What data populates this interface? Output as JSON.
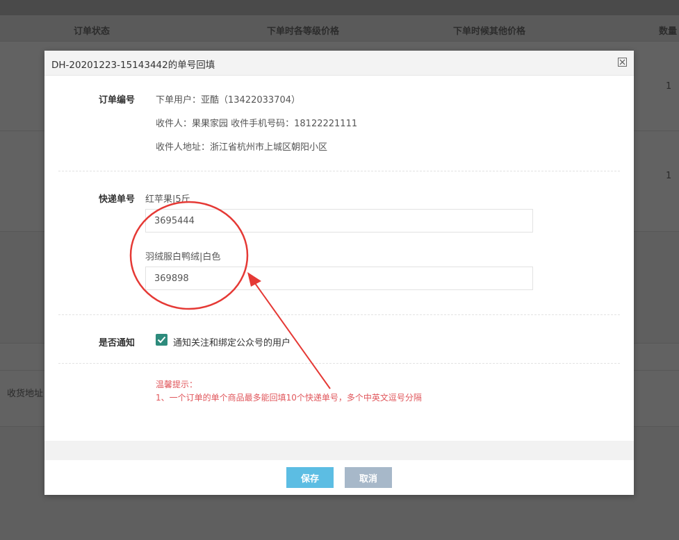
{
  "background": {
    "columns": [
      "订单状态",
      "下单时各等级价格",
      "下单时候其他价格",
      "数量"
    ],
    "row_quantities": [
      "1",
      "1"
    ],
    "side_label": "收货地址"
  },
  "modal": {
    "title": "DH-20201223-15143442的单号回填",
    "order_section": {
      "label": "订单编号",
      "user": "下单用户：亚酷（13422033704）",
      "receiver": "收件人：果果家园 收件手机号码：18122221111",
      "address": "收件人地址：浙江省杭州市上城区朝阳小区"
    },
    "tracking_section": {
      "label": "快递单号",
      "items": [
        {
          "product": "红苹果|5斤",
          "value": "3695444"
        },
        {
          "product": "羽绒服白鸭绒|白色",
          "value": "369898"
        }
      ]
    },
    "notify_section": {
      "label": "是否通知",
      "checkbox_label": "通知关注和绑定公众号的用户",
      "checked": true
    },
    "tips": {
      "title": "温馨提示：",
      "line1": "1、一个订单的单个商品最多能回填10个快递单号，多个中英文逗号分隔"
    },
    "buttons": {
      "save": "保存",
      "cancel": "取消"
    }
  },
  "colors": {
    "accent_save": "#5cbde3",
    "cancel": "#a7b8c9",
    "checkbox": "#2d8b7c",
    "tip": "#e0565b",
    "annotation": "#e53935"
  },
  "icons": {
    "close": "close-icon",
    "check": "check-icon"
  }
}
